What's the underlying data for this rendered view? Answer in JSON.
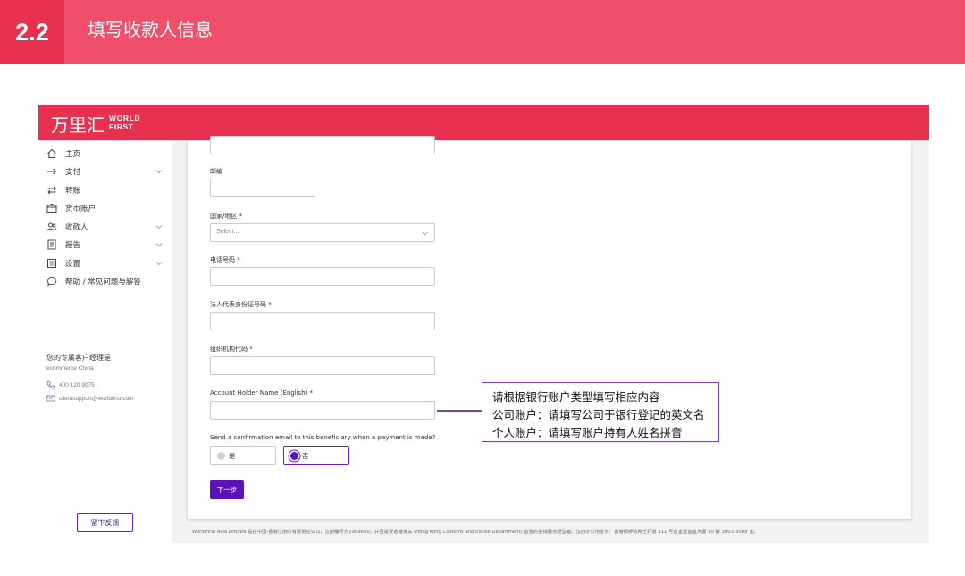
{
  "slide": {
    "number": "2.2",
    "title": "填写收款人信息"
  },
  "app": {
    "logo_cn": "万里汇",
    "logo_en_1": "WORLD",
    "logo_en_2": "FIRST",
    "nav": [
      {
        "label": "主页",
        "icon": "home-icon",
        "expandable": false
      },
      {
        "label": "支付",
        "icon": "arrow-right-icon",
        "expandable": true
      },
      {
        "label": "转账",
        "icon": "transfer-icon",
        "expandable": false
      },
      {
        "label": "货币账户",
        "icon": "wallet-icon",
        "expandable": false
      },
      {
        "label": "收款人",
        "icon": "users-icon",
        "expandable": true
      },
      {
        "label": "报告",
        "icon": "report-icon",
        "expandable": true
      },
      {
        "label": "设置",
        "icon": "settings-icon",
        "expandable": true
      },
      {
        "label": "帮助 / 常见问题与解答",
        "icon": "chat-help-icon",
        "expandable": false
      }
    ],
    "manager": {
      "title": "您的专属客户经理是",
      "name": "ecommerce China",
      "phone": "400 120 9075",
      "email": "clientsupport@worldfirst.com"
    },
    "feedback_label": "留下反馈"
  },
  "form": {
    "postcode_label": "邮编",
    "country_label": "国家/地区 *",
    "country_placeholder": "Select...",
    "phone_label": "电话号码 *",
    "legal_id_label": "法人代表身份证号码 *",
    "org_code_label": "组织机构代码 *",
    "holder_name_label": "Account Holder Name (English) *",
    "email_confirm_label": "Send a confirmation email to this beneficiary when a payment is made?",
    "option_yes": "是",
    "option_no": "否",
    "selected_option": "否",
    "next_label": "下一步"
  },
  "footer_text": "WorldFirst Asia Limited 是在中国·香港注册的有限责任公司，注册编号为1989650，并且是受香港海关 (Hong Kong Customs and Excise Department) 监管的金钱服务经营者。注册办公地址为：香港铜锣湾希士打道 311 号皇室堡皇室大厦 30 楼 3003-3008 室。",
  "callout": {
    "line1": "请根据银行账户类型填写相应内容",
    "line2": "公司账户：请填写公司于银行登记的英文名",
    "line3": "个人账户：请填写账户持有人姓名拼音"
  },
  "colors": {
    "header": "#ef4f6b",
    "brand_red": "#e8304f",
    "accent_purple": "#5b12b8"
  }
}
